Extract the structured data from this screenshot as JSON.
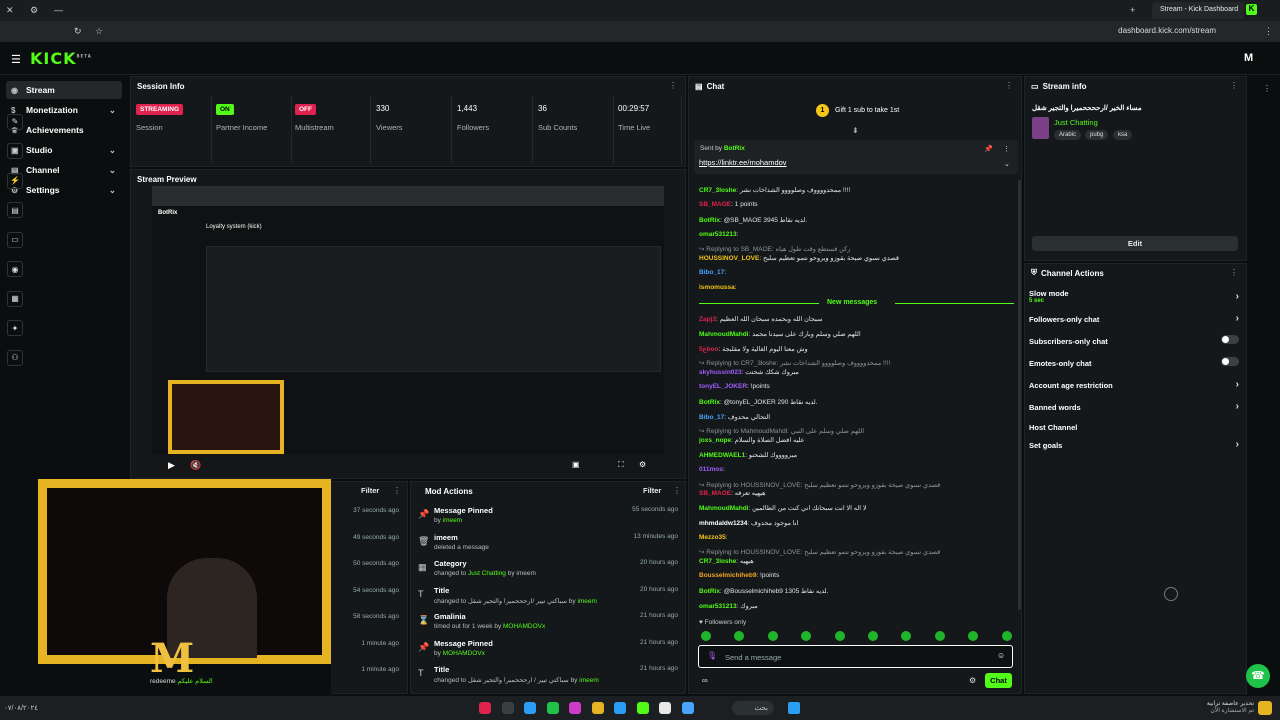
{
  "browser": {
    "tab_title": "Stream - Kick Dashboard",
    "url": "dashboard.kick.com/stream"
  },
  "brand": {
    "logo": "KICK",
    "logo_sup": "BETA",
    "accent": "#53fc18"
  },
  "sidebar": {
    "items": [
      {
        "label": "Stream",
        "icon": "broadcast-icon"
      },
      {
        "label": "Monetization",
        "icon": "dollar-icon"
      },
      {
        "label": "Achievements",
        "icon": "trophy-icon"
      },
      {
        "label": "Studio",
        "icon": "studio-icon"
      },
      {
        "label": "Channel",
        "icon": "channel-icon"
      },
      {
        "label": "Settings",
        "icon": "gear-icon"
      }
    ]
  },
  "session_info": {
    "title": "Session Info",
    "stats": [
      {
        "badge": "STREAMING",
        "label": "Session",
        "color": "#e0234e"
      },
      {
        "badge": "ON",
        "label": "Partner Income",
        "color": "#53fc18"
      },
      {
        "badge": "OFF",
        "label": "Multistream",
        "color": "#e0234e"
      },
      {
        "value": "330",
        "label": "Viewers"
      },
      {
        "value": "1,443",
        "label": "Followers"
      },
      {
        "value": "36",
        "label": "Sub Counts"
      },
      {
        "value": "00:29:57",
        "label": "Time Live"
      }
    ]
  },
  "stream_preview": {
    "title": "Stream Preview",
    "inner_title": "Loyalty system (kick)",
    "inner_brand": "BotRix"
  },
  "activity": {
    "filter": "Filter",
    "rows": [
      {
        "time": "37 seconds ago"
      },
      {
        "time": "49 seconds ago"
      },
      {
        "time": "50 seconds ago"
      },
      {
        "time": "54 seconds ago"
      },
      {
        "time": "58 seconds ago"
      },
      {
        "time": "1 minute ago"
      },
      {
        "time": "1 minute ago"
      }
    ],
    "partial_text": "redeeme",
    "partial_ar": "السلام عليكم"
  },
  "mod_actions": {
    "title": "Mod Actions",
    "filter": "Filter",
    "rows": [
      {
        "icon": "pin-icon",
        "title": "Message Pinned",
        "sub_pre": "by ",
        "sub_user": "imeem",
        "sub_post": "",
        "time": "55 seconds ago"
      },
      {
        "icon": "trash-icon",
        "title": "imeem",
        "sub_pre": "deleted a message",
        "sub_user": "",
        "sub_post": "",
        "time": "13 minutes ago"
      },
      {
        "icon": "category-icon",
        "title": "Category",
        "sub_pre": "changed to ",
        "sub_user": "Just Chatting",
        "sub_post": " by imeem",
        "time": "20 hours ago"
      },
      {
        "icon": "title-icon",
        "title": "Title",
        "sub_pre": "changed to سباكتي تيير /ارحححميرا والتجير شقل by ",
        "sub_user": "imeem",
        "sub_post": "",
        "time": "20 hours ago"
      },
      {
        "icon": "hourglass-icon",
        "title": "Gmalinia",
        "sub_pre": "timed out for 1 week by ",
        "sub_user": "MOHAMDOVx",
        "sub_post": "",
        "time": "21 hours ago"
      },
      {
        "icon": "pin-icon",
        "title": "Message Pinned",
        "sub_pre": "by ",
        "sub_user": "MOHAMDOVx",
        "sub_post": "",
        "time": "21 hours ago"
      },
      {
        "icon": "title-icon",
        "title": "Title",
        "sub_pre": "changed to سباكتي تيير / ارحححميرا والتجير شقل by ",
        "sub_user": "imeem",
        "sub_post": "",
        "time": "21 hours ago"
      }
    ]
  },
  "chat": {
    "title": "Chat",
    "gift_banner": "Gift 1 sub to take 1st",
    "gift_count": "1",
    "pinned": {
      "sent_by": "Sent by",
      "user": "BotRix",
      "link": "https://linktr.ee/mohamdov"
    },
    "new_messages": "New messages",
    "followers_only": "Followers only",
    "input_placeholder": "Send a message",
    "send_label": "Chat",
    "lines": [
      {
        "user": "CR7_3loshe",
        "color": "#53fc18",
        "text": ": ممحدووووف وصلوووو الشداخات نشر !!!!"
      },
      {
        "user": "SB_MAOE",
        "color": "#e0234e",
        "text": ": 1 points"
      },
      {
        "user": "BotRix",
        "color": "#53fc18",
        "text": ": @SB_MAOE لديه نقاط 3945."
      },
      {
        "user": "omar531213",
        "color": "#53fc18",
        "text": ":"
      },
      {
        "user": "",
        "color": "#9aa",
        "text": "↪ Replying to SB_MAOE: ركن فستطع وقت طول هياه"
      },
      {
        "user": "HOUSSINOV_LOVE",
        "color": "#f5c518",
        "text": ": قصدي نسوي صيحة بقوزو ويروحو نتمو تعظيم سلبح"
      },
      {
        "user": "Bibo_17",
        "color": "#4aa3ff",
        "text": ":"
      },
      {
        "user": "ismomussa",
        "color": "#f5c518",
        "text": ":"
      },
      {
        "user": "Zapj3",
        "color": "#e0234e",
        "text": ": سبحان الله وبحمده سبحان الله العظيم"
      },
      {
        "user": "MahmoudMahdi",
        "color": "#53fc18",
        "text": ": اللهم صلي وسلم وبارك على سيدنا محمد"
      },
      {
        "user": "ع5boo",
        "color": "#e0234e",
        "text": ": وش معنا اليوم الغالية ولا مقلبجة"
      },
      {
        "user": "",
        "color": "#9aa",
        "text": "↪ Replying to CR7_3loshe: ممحدووووف وصلوووو الشداخات نشر !!!!"
      },
      {
        "user": "skyhussin023",
        "color": "#a45cff",
        "text": ": مبروك شكك شحتت"
      },
      {
        "user": "tonyEL_JOKER",
        "color": "#a45cff",
        "text": ": !points"
      },
      {
        "user": "BotRix",
        "color": "#53fc18",
        "text": ": @tonyEL_JOKER لديه نقاط 290."
      },
      {
        "user": "Bibo_17",
        "color": "#4aa3ff",
        "text": ": التحالي محدوف"
      },
      {
        "user": "",
        "color": "#9aa",
        "text": "↪ Replying to MahmoudMahdi: اللهم صلي وسلم على النبي"
      },
      {
        "user": "joxs_nope",
        "color": "#53fc18",
        "text": ": عليه افضل الصلاة والسلام"
      },
      {
        "user": "AHMEDWAEL1",
        "color": "#53fc18",
        "text": ": مبرووووك للشحنو"
      },
      {
        "user": "011mos",
        "color": "#a45cff",
        "text": ":"
      },
      {
        "user": "",
        "color": "#9aa",
        "text": "↪ Replying to HOUSSINOV_LOVE: قصدي نسوي صيحة بقوزو ويروحو نتمو تعظيم سلبح"
      },
      {
        "user": "SB_MAOE",
        "color": "#e0234e",
        "text": ": هيهيه تعرفه"
      },
      {
        "user": "MahmoudMahdi",
        "color": "#53fc18",
        "text": ": لا اله الا انت سبحانك اني كنت من الظالمين"
      },
      {
        "user": "mhmdaldw1234",
        "color": "#ffffff",
        "text": ": انا موجود محدوف"
      },
      {
        "user": "Mezzo35",
        "color": "#f5c518",
        "text": ":"
      },
      {
        "user": "",
        "color": "#9aa",
        "text": "↪ Replying to HOUSSINOV_LOVE: قصدي نسوي صيحة بقوزو ويروحو نتمو تعظيم سلبح"
      },
      {
        "user": "CR7_3loshe",
        "color": "#53fc18",
        "text": ": هيهيه"
      },
      {
        "user": "Bousselmichiheb9",
        "color": "#f5a623",
        "text": ": !points"
      },
      {
        "user": "BotRix",
        "color": "#53fc18",
        "text": ": @Bousselmichiheb9 لديه نقاط 1305."
      },
      {
        "user": "omar531213",
        "color": "#53fc18",
        "text": ": مبروك"
      }
    ]
  },
  "stream_info": {
    "title": "Stream info",
    "stream_title": "مساء الخير /ارححححميرا والتجير شقل",
    "category": "Just Chatting",
    "tags": [
      "Arabic",
      "pubg",
      "ksa"
    ],
    "edit_label": "Edit"
  },
  "channel_actions": {
    "title": "Channel Actions",
    "items": [
      {
        "label": "Slow mode",
        "sub": "5 sec",
        "control": "chevron"
      },
      {
        "label": "Followers-only chat",
        "sub": "",
        "control": "chevron"
      },
      {
        "label": "Subscribers-only chat",
        "sub": "",
        "control": "toggle"
      },
      {
        "label": "Emotes-only chat",
        "sub": "",
        "control": "toggle"
      },
      {
        "label": "Account age restriction",
        "sub": "",
        "control": "chevron"
      },
      {
        "label": "Banned words",
        "sub": "",
        "control": "chevron"
      },
      {
        "label": "Host Channel",
        "sub": "",
        "control": "none"
      },
      {
        "label": "Set goals",
        "sub": "",
        "control": "chevron"
      }
    ]
  },
  "taskbar": {
    "search": "بحث",
    "notice_line1": "تحذير عاصفة ترابية",
    "notice_line2": "تم الاستشارة الآن",
    "clock": "٠٧/٠٨/٢٠٢٤"
  }
}
